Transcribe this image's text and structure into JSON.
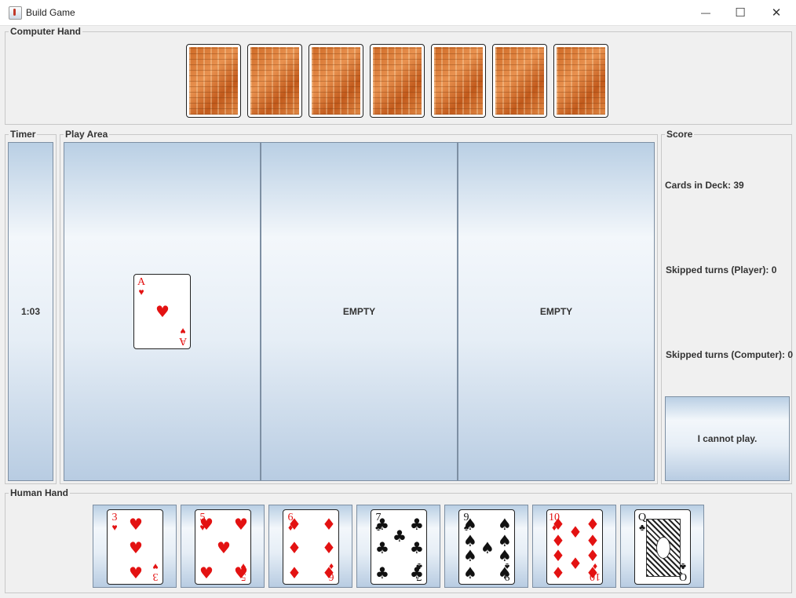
{
  "window": {
    "title": "Build Game",
    "minimize_glyph": "—",
    "maximize_glyph": "☐",
    "close_glyph": "✕"
  },
  "computer_hand": {
    "legend": "Computer Hand",
    "card_count": 7
  },
  "timer": {
    "legend": "Timer",
    "value": "1:03"
  },
  "play_area": {
    "legend": "Play Area",
    "slot_card": {
      "rank": "A",
      "suit": "♥",
      "color": "#e31212"
    },
    "empty_label_2": "EMPTY",
    "empty_label_3": "EMPTY"
  },
  "score": {
    "legend": "Score",
    "cards_in_deck": "Cards in Deck: 39",
    "skipped_player": "Skipped turns (Player): 0",
    "skipped_computer": "Skipped turns (Computer): 0",
    "cannot_play_button": "I cannot play."
  },
  "human_hand": {
    "legend": "Human Hand",
    "cards": [
      {
        "rank": "3",
        "suit": "♥",
        "color": "red"
      },
      {
        "rank": "5",
        "suit": "♥",
        "color": "red"
      },
      {
        "rank": "6",
        "suit": "♦",
        "color": "red"
      },
      {
        "rank": "7",
        "suit": "♣",
        "color": "black"
      },
      {
        "rank": "9",
        "suit": "♠",
        "color": "black"
      },
      {
        "rank": "10",
        "suit": "♦",
        "color": "red"
      },
      {
        "rank": "Q",
        "suit": "♣",
        "color": "black"
      }
    ]
  },
  "colors": {
    "card_red": "#e31212",
    "card_black": "#111111",
    "panel_border": "#7d8fa3",
    "back_orange": "#d9783a"
  }
}
